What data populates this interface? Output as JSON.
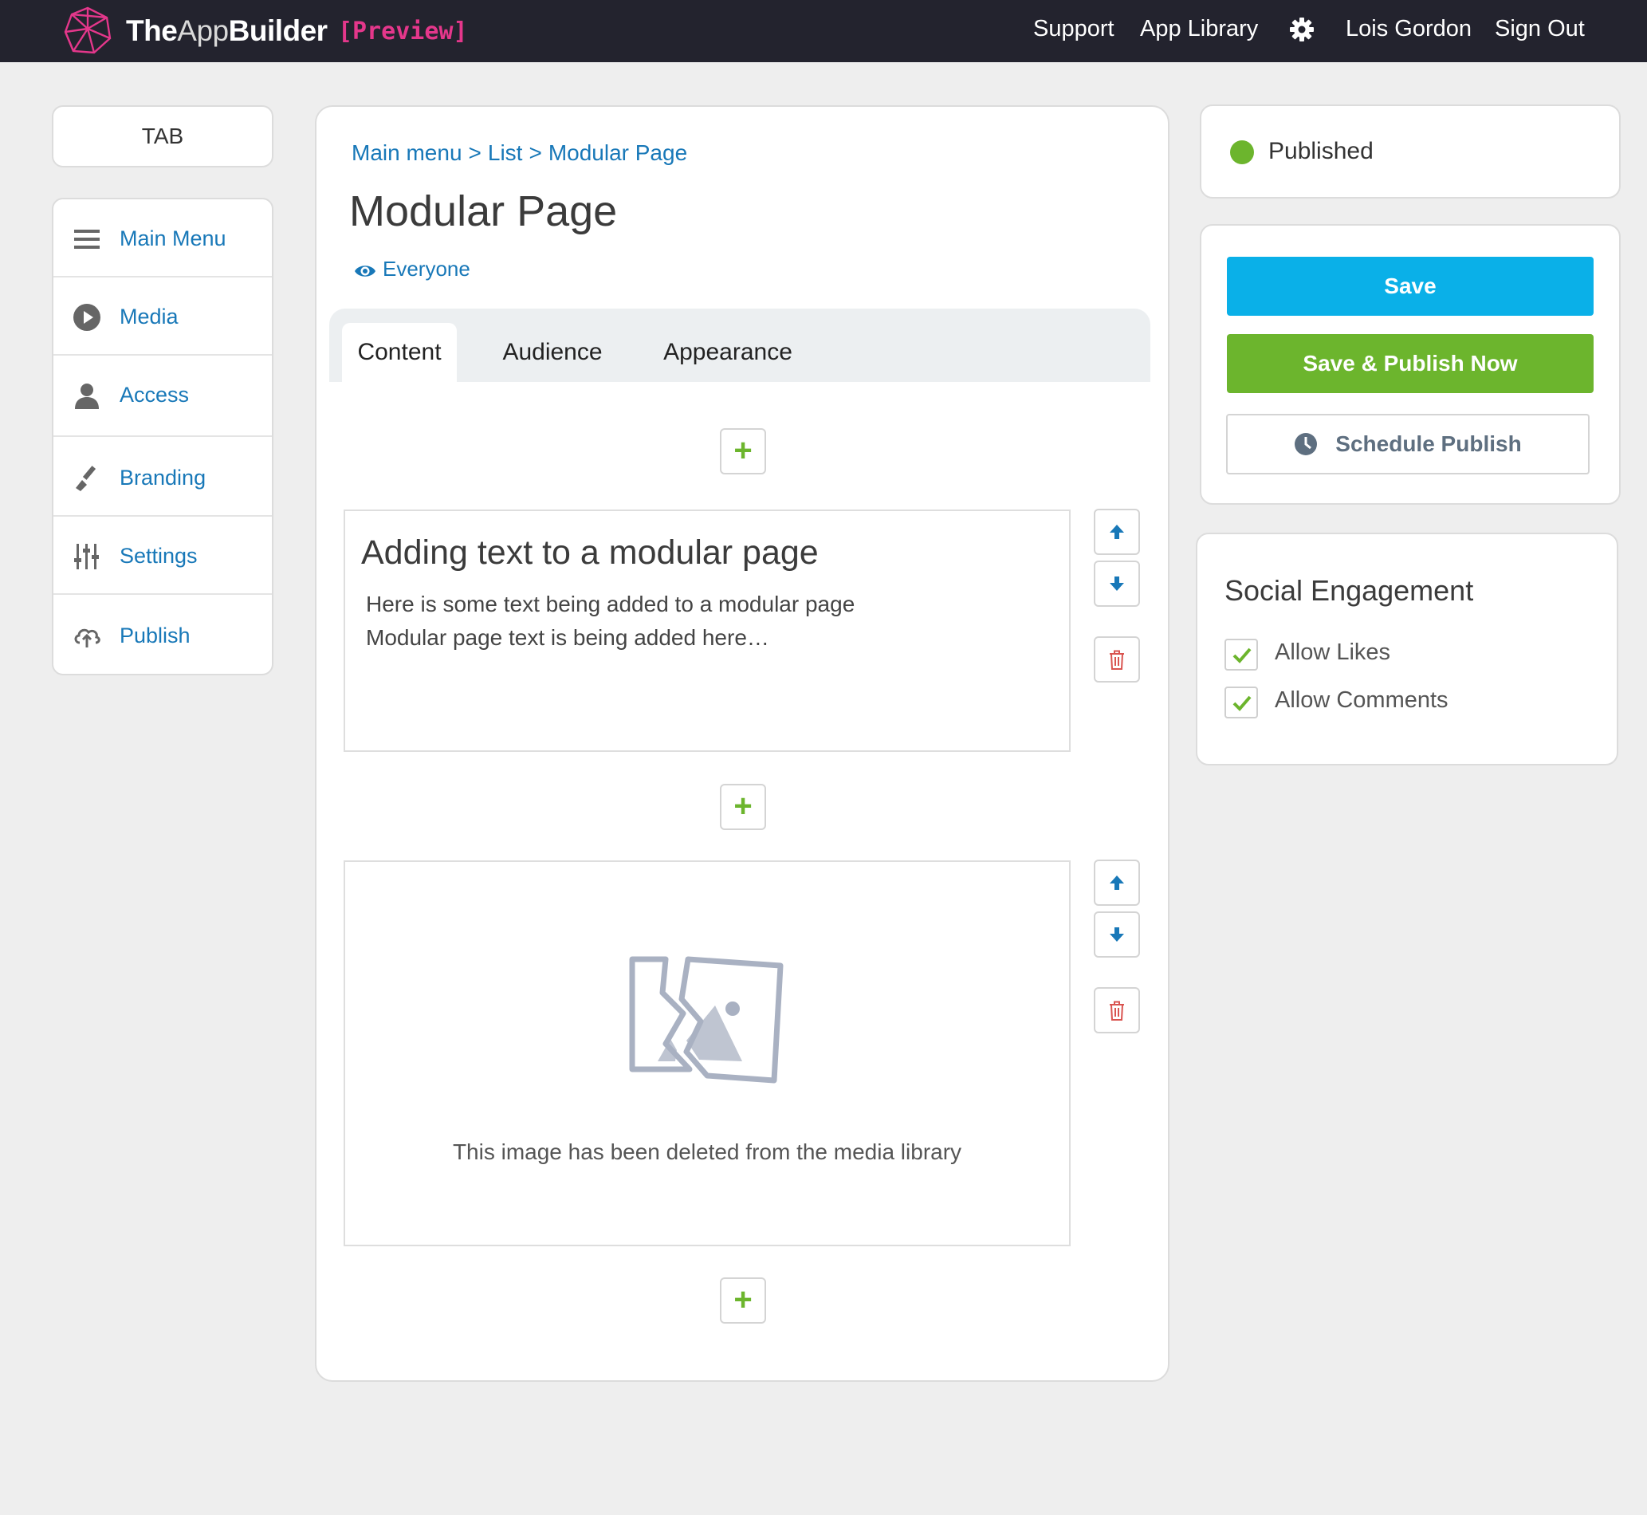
{
  "header": {
    "brand_bold_1": "The",
    "brand_light": "App",
    "brand_bold_2": "Builder",
    "brand_tag": "[Preview]",
    "nav": [
      "Support",
      "App Library"
    ],
    "user_name": "Lois Gordon",
    "sign_out": "Sign Out",
    "background_color": "#23232e",
    "tag_color": "#e4378b"
  },
  "sidebar": {
    "tab_label": "TAB",
    "items": [
      {
        "label": "Main Menu",
        "icon": "hamburger-icon"
      },
      {
        "label": "Media",
        "icon": "play-icon"
      },
      {
        "label": "Access",
        "icon": "user-icon"
      },
      {
        "label": "Branding",
        "icon": "paintbrush-icon"
      },
      {
        "label": "Settings",
        "icon": "sliders-icon"
      },
      {
        "label": "Publish",
        "icon": "cloud-upload-icon"
      }
    ]
  },
  "main": {
    "breadcrumb": [
      "Main menu",
      "List",
      "Modular Page"
    ],
    "breadcrumb_separator": ">",
    "title": "Modular Page",
    "audience": "Everyone",
    "tabs": [
      "Content",
      "Audience",
      "Appearance"
    ],
    "active_tab": "Content",
    "add_label": "+",
    "text_module": {
      "heading": "Adding text to a modular page",
      "lines": [
        "Here is some text being added to a modular page",
        "Modular page text is being added here…"
      ]
    },
    "image_module": {
      "message": "This image has been deleted from the media library"
    }
  },
  "right": {
    "status": "Published",
    "status_color": "#6cb52d",
    "save_label": "Save",
    "save_color": "#0ab0e8",
    "publish_label": "Save & Publish Now",
    "publish_color": "#6cb52d",
    "schedule_label": "Schedule Publish",
    "social_title": "Social Engagement",
    "allow_likes": "Allow Likes",
    "allow_comments": "Allow Comments",
    "likes_checked": true,
    "comments_checked": true
  }
}
